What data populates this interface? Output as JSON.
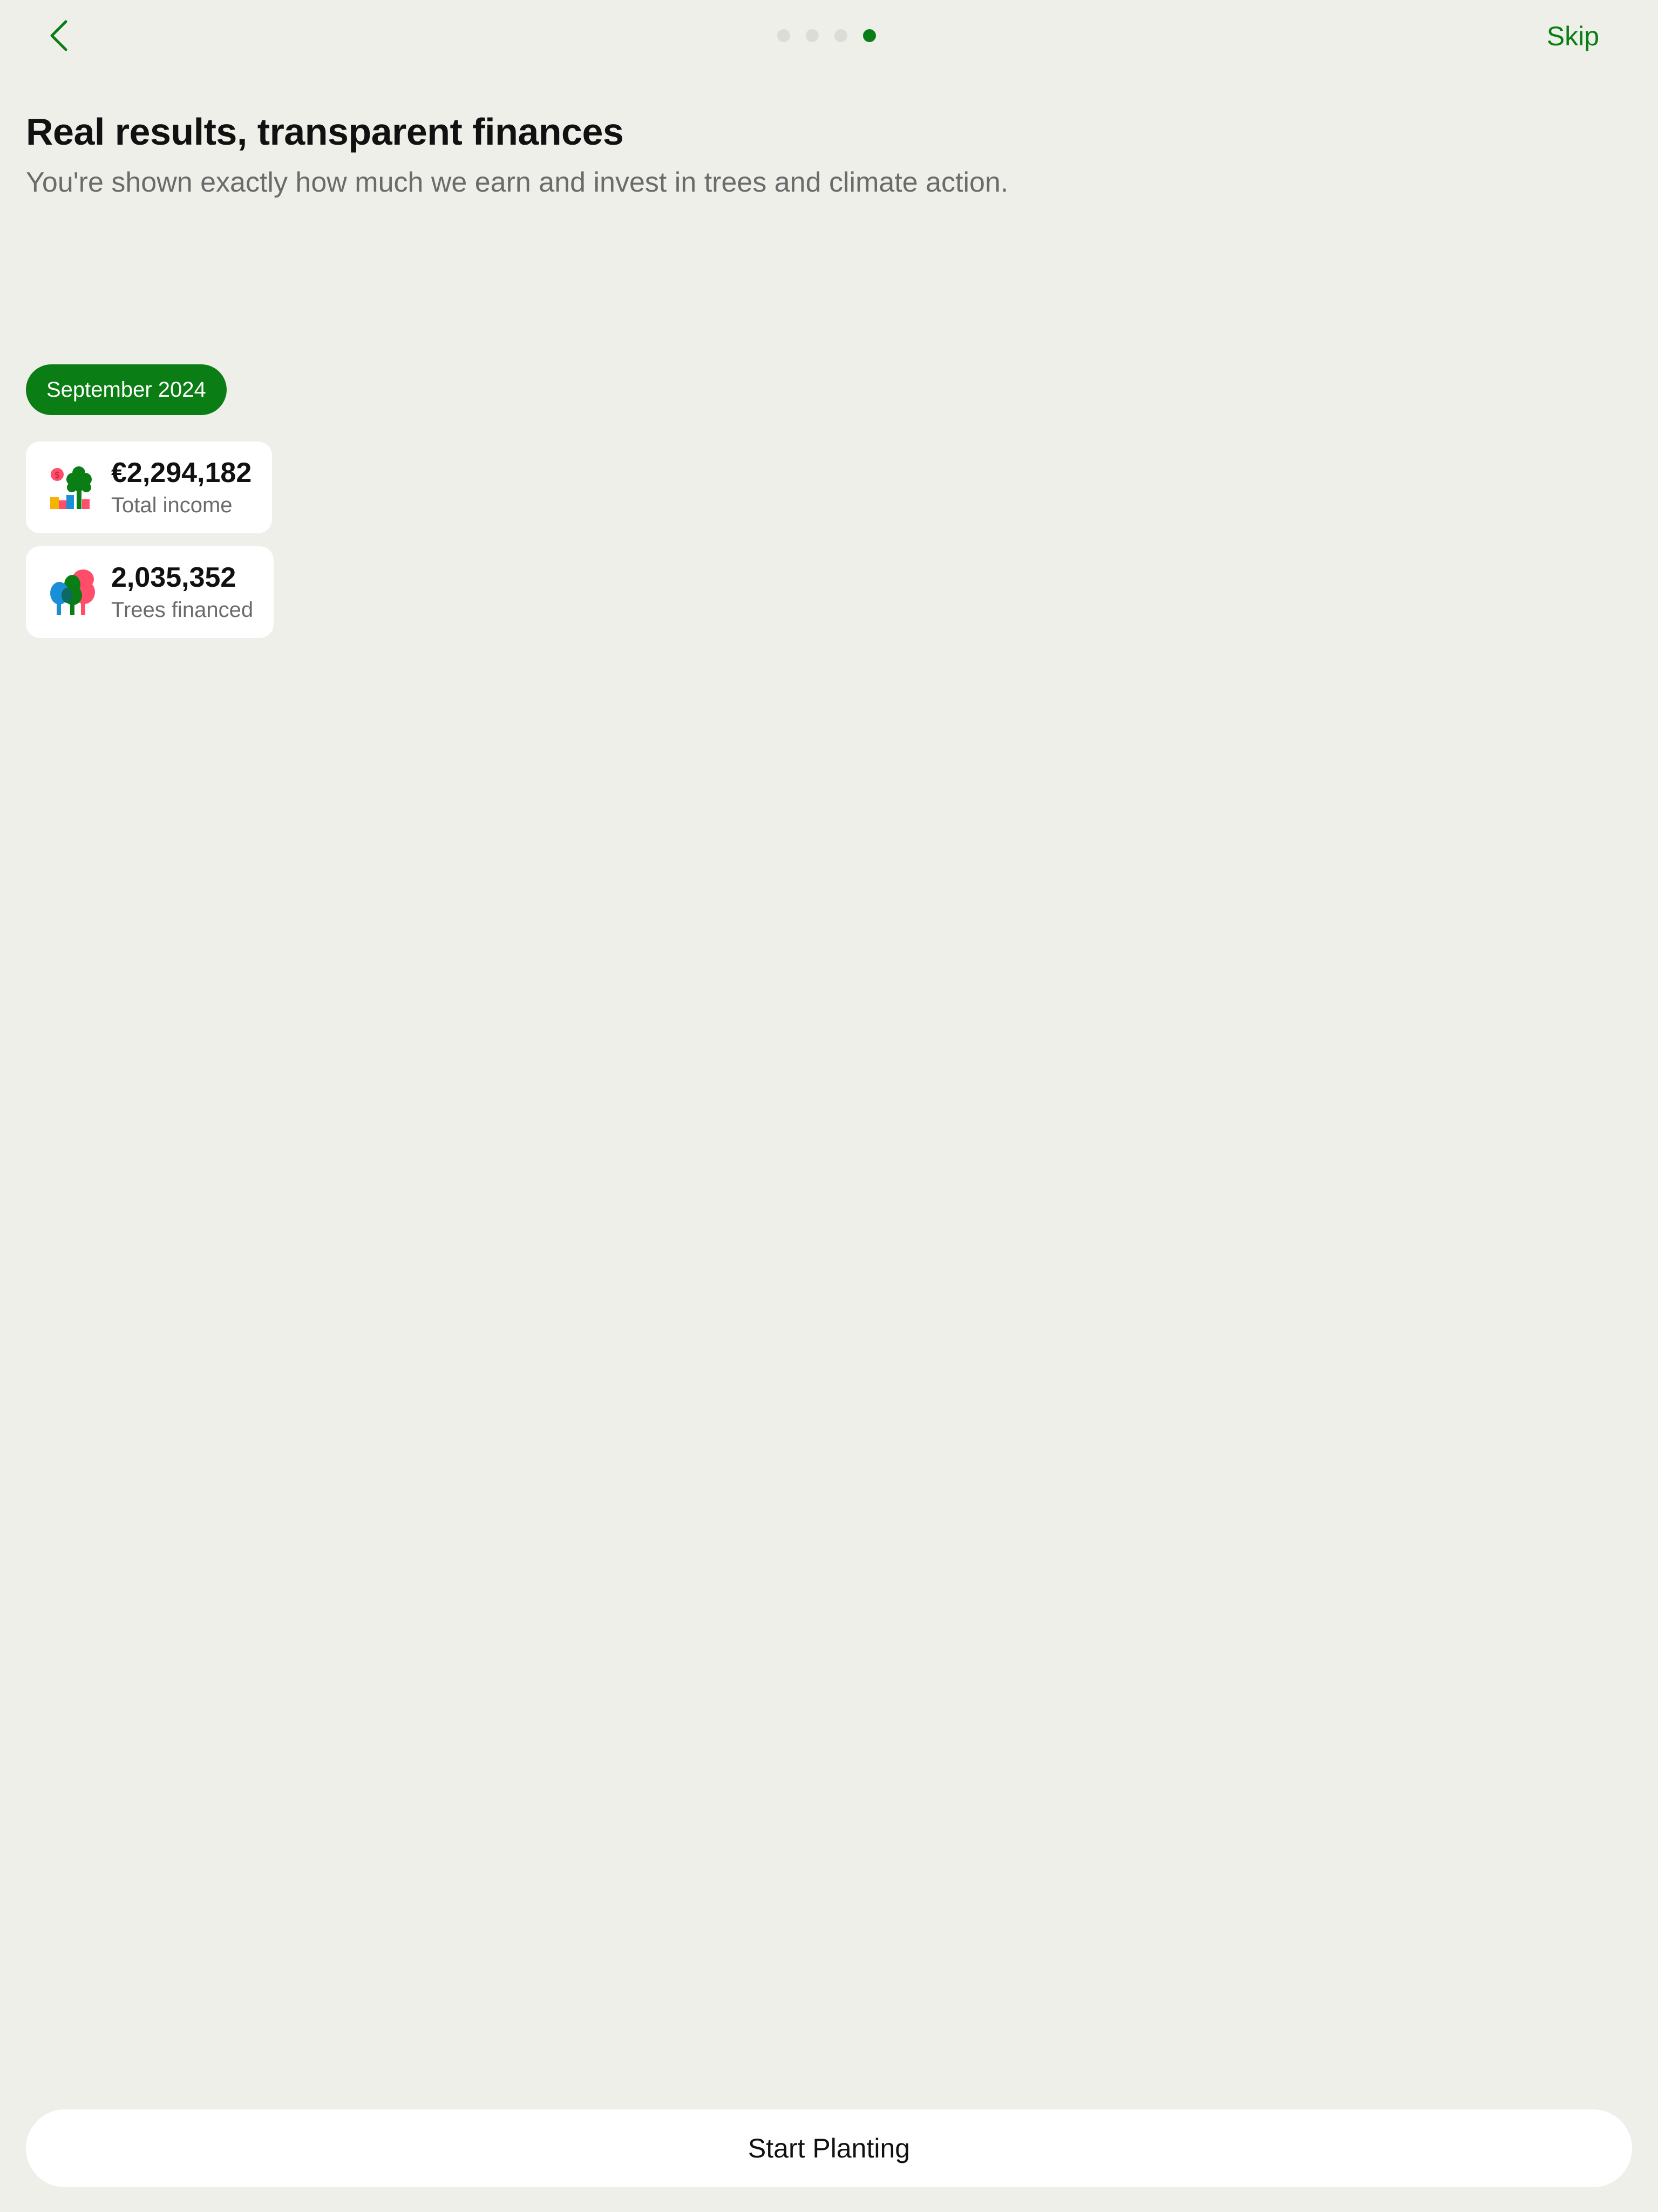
{
  "nav": {
    "back_icon": "chevron-left-icon",
    "skip_label": "Skip",
    "pager": {
      "count": 4,
      "active_index": 3
    }
  },
  "header": {
    "title": "Real results, transparent finances",
    "subtitle": "You're shown exactly how much we earn and invest in trees and climate action."
  },
  "report": {
    "month_label": "September 2024",
    "stats": [
      {
        "icon": "income-tree-icon",
        "value": "€2,294,182",
        "label": "Total income"
      },
      {
        "icon": "trees-icon",
        "value": "2,035,352",
        "label": "Trees financed"
      }
    ]
  },
  "footer": {
    "cta_label": "Start Planting"
  },
  "colors": {
    "background": "#efefea",
    "accent": "#0a7d14",
    "muted_text": "#6b6b6b",
    "card": "#ffffff"
  }
}
